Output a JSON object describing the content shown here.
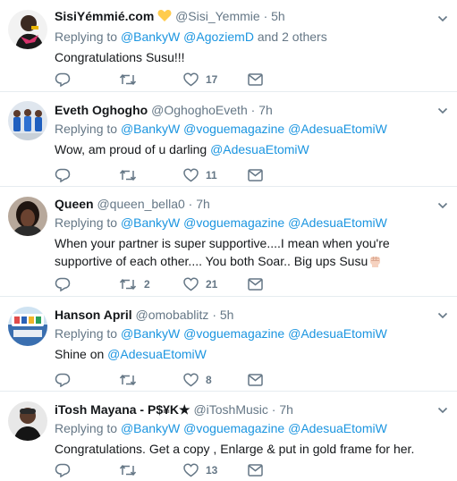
{
  "tweets": [
    {
      "name": "SisiYémmié.com",
      "handle": "@Sisi_Yemmie",
      "dot": "·",
      "time": "5h",
      "reply_prefix": "Replying to",
      "reply_mentions": "@BankyW @AgoziemD",
      "reply_suffix": "and 2 others",
      "text": "Congratulations Susu!!!",
      "replies": "",
      "retweets": "",
      "likes": "17",
      "badge_icon": "yellow-heart-emoji"
    },
    {
      "name": "Eveth Oghogho",
      "handle": "@OghoghoEveth",
      "dot": "·",
      "time": "7h",
      "reply_prefix": "Replying to",
      "reply_mentions": "@BankyW @voguemagazine @AdesuaEtomiW",
      "text_prefix": "Wow, am proud of u darling ",
      "text_mention": "@AdesuaEtomiW",
      "replies": "",
      "retweets": "",
      "likes": "11"
    },
    {
      "name": "Queen",
      "handle": "@queen_bella0",
      "dot": "·",
      "time": "7h",
      "reply_prefix": "Replying to",
      "reply_mentions": "@BankyW @voguemagazine @AdesuaEtomiW",
      "text": "When your partner is super supportive....I mean when you're supportive of each other.... You both Soar.. Big ups Susu",
      "text_emoji": "raised-fist-emoji",
      "replies": "",
      "retweets": "2",
      "likes": "21"
    },
    {
      "name": "Hanson April",
      "handle": "@omobablitz",
      "dot": "·",
      "time": "5h",
      "reply_prefix": "Replying to",
      "reply_mentions": "@BankyW @voguemagazine @AdesuaEtomiW",
      "text_prefix": "Shine on ",
      "text_mention": "@AdesuaEtomiW",
      "replies": "",
      "retweets": "",
      "likes": "8"
    },
    {
      "name": "iTosh Mayana - P$¥K★",
      "handle": "@iToshMusic",
      "dot": "·",
      "time": "7h",
      "reply_prefix": "Replying to",
      "reply_mentions": "@BankyW @voguemagazine @AdesuaEtomiW",
      "text": "Congratulations. Get a copy , Enlarge & put in gold frame for her.",
      "replies": "",
      "retweets": "",
      "likes": "13"
    }
  ],
  "colors": {
    "text": "#14171a",
    "secondary": "#657786",
    "link": "#1b95e0",
    "divider": "#e6ecf0"
  },
  "icons": [
    "reply-icon",
    "retweet-icon",
    "like-icon",
    "dm-icon",
    "caret-down-icon"
  ]
}
